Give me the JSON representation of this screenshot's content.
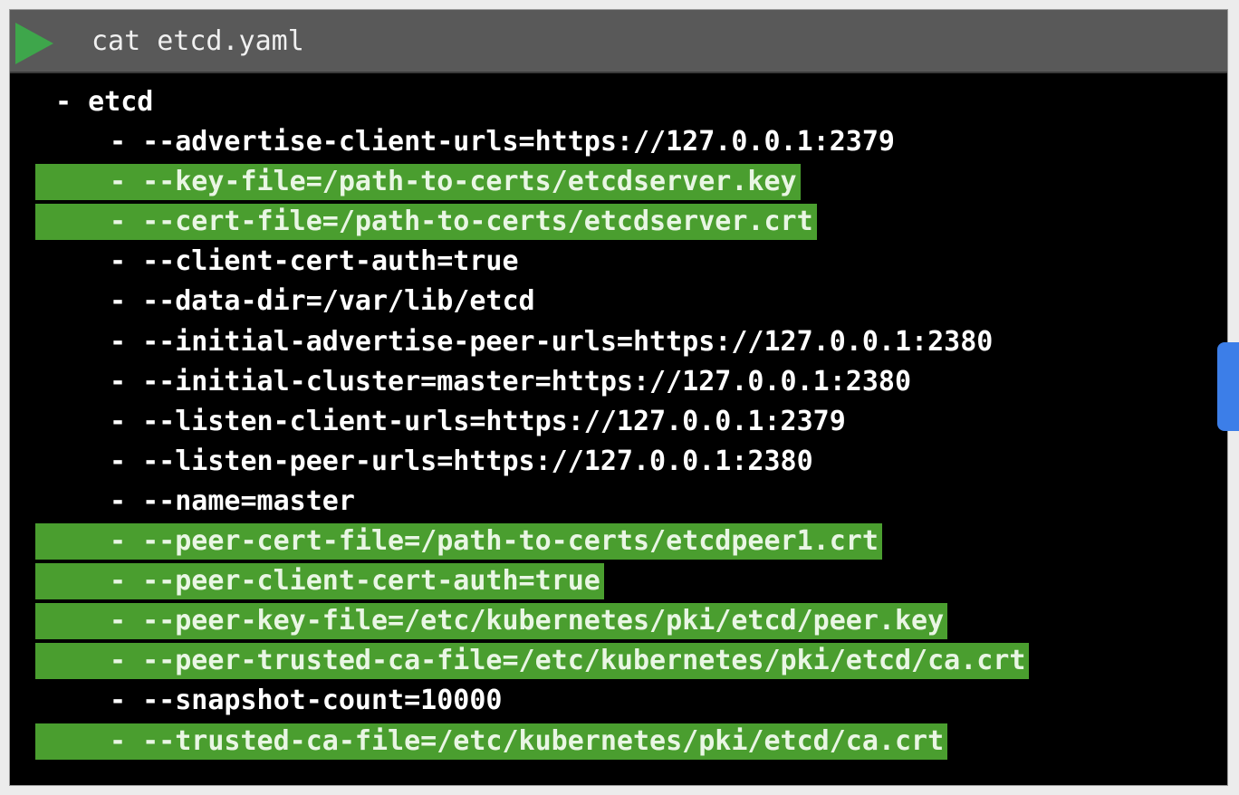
{
  "titlebar": {
    "command": "cat etcd.yaml",
    "play_icon": "play-triangle-icon",
    "accent": "#3ea64b"
  },
  "highlight_color": "#4a9e2f",
  "lines": [
    {
      "text": "- etcd",
      "indent": 0,
      "highlighted": false
    },
    {
      "text": "- --advertise-client-urls=https://127.0.0.1:2379",
      "indent": 1,
      "highlighted": false
    },
    {
      "text": "- --key-file=/path-to-certs/etcdserver.key",
      "indent": 1,
      "highlighted": true
    },
    {
      "text": "- --cert-file=/path-to-certs/etcdserver.crt",
      "indent": 1,
      "highlighted": true
    },
    {
      "text": "- --client-cert-auth=true",
      "indent": 1,
      "highlighted": false
    },
    {
      "text": "- --data-dir=/var/lib/etcd",
      "indent": 1,
      "highlighted": false
    },
    {
      "text": "- --initial-advertise-peer-urls=https://127.0.0.1:2380",
      "indent": 1,
      "highlighted": false
    },
    {
      "text": "- --initial-cluster=master=https://127.0.0.1:2380",
      "indent": 1,
      "highlighted": false
    },
    {
      "text": "- --listen-client-urls=https://127.0.0.1:2379",
      "indent": 1,
      "highlighted": false
    },
    {
      "text": "- --listen-peer-urls=https://127.0.0.1:2380",
      "indent": 1,
      "highlighted": false
    },
    {
      "text": "- --name=master",
      "indent": 1,
      "highlighted": false
    },
    {
      "text": "- --peer-cert-file=/path-to-certs/etcdpeer1.crt",
      "indent": 1,
      "highlighted": true
    },
    {
      "text": "- --peer-client-cert-auth=true",
      "indent": 1,
      "highlighted": true
    },
    {
      "text": "- --peer-key-file=/etc/kubernetes/pki/etcd/peer.key",
      "indent": 1,
      "highlighted": true
    },
    {
      "text": "- --peer-trusted-ca-file=/etc/kubernetes/pki/etcd/ca.crt",
      "indent": 1,
      "highlighted": true
    },
    {
      "text": "- --snapshot-count=10000",
      "indent": 1,
      "highlighted": false
    },
    {
      "text": "- --trusted-ca-file=/etc/kubernetes/pki/etcd/ca.crt",
      "indent": 1,
      "highlighted": true
    }
  ],
  "side_tab_color": "#3c7ee8"
}
